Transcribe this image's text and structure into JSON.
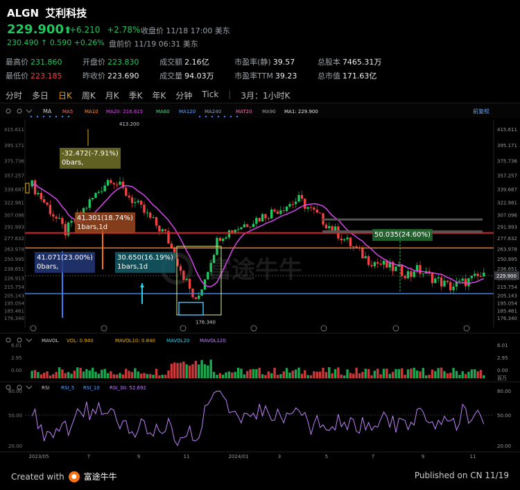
{
  "header": {
    "ticker": "ALGN",
    "name": "艾利科技",
    "price": "229.900",
    "arrow": "⬆",
    "change": "+6.210",
    "change_pct": "+2.78%",
    "status": "收盘价 11/18 17:00 美东",
    "pre_price": "230.490 ↑ 0.590 +0.26%",
    "pre_status": "盘前价 11/19 06:31 美东"
  },
  "stats": [
    {
      "k": "最高价",
      "v": "231.860",
      "tone": "up"
    },
    {
      "k": "开盘价",
      "v": "223.830",
      "tone": "up"
    },
    {
      "k": "成交额",
      "v": "2.16亿",
      "tone": ""
    },
    {
      "k": "市盈率(静)",
      "v": "39.57",
      "tone": ""
    },
    {
      "k": "总股本",
      "v": "7465.31万",
      "tone": ""
    },
    {
      "k": "最低价",
      "v": "223.185",
      "tone": "down"
    },
    {
      "k": "昨收价",
      "v": "223.690",
      "tone": ""
    },
    {
      "k": "成交量",
      "v": "94.03万",
      "tone": ""
    },
    {
      "k": "市盈率TTM",
      "v": "39.23",
      "tone": ""
    },
    {
      "k": "总市值",
      "v": "171.63亿",
      "tone": ""
    }
  ],
  "tabs": [
    "分时",
    "多日",
    "日K",
    "周K",
    "月K",
    "季K",
    "年K",
    "分钟",
    "Tick"
  ],
  "active_tab": "日K",
  "period": "3月：1小时K",
  "toolbar": {
    "ma": "MA",
    "ma5": "MA5",
    "ma10": "MA10",
    "ma20": "MA20: 216.615",
    "ma60": "MA60",
    "ma120": "MA120",
    "ma240": "MA240",
    "mat20": "MAT20",
    "ma90": "MA90",
    "ma1": "MA1: 229.900",
    "fq": "前复权"
  },
  "annotations": [
    {
      "text1": "-32.472(-7.91%)",
      "text2": "0bars,"
    },
    {
      "text1": "41.301(18.74%)",
      "text2": "1bars,1d"
    },
    {
      "text1": "41.071(23.00%)",
      "text2": "0bars,"
    },
    {
      "text1": "30.650(16.19%)",
      "text2": "1bars,1d"
    },
    {
      "text1": "50.035(24.60%)",
      "text2": ""
    }
  ],
  "peak_label": "413.200",
  "low_label": "176.340",
  "price_axis": [
    "415.611",
    "395.171",
    "375.736",
    "357.257",
    "339.687",
    "322.981",
    "307.096",
    "291.993",
    "277.632",
    "263.978",
    "250.995",
    "238.651",
    "226.913",
    "215.754",
    "205.143",
    "195.054",
    "185.461",
    "176.340"
  ],
  "current_price_tag": "229.900",
  "volume_panel": {
    "label": "MAVOL",
    "vol": "VOL: 0.940",
    "mavol10": "MAVOL10: 0.840",
    "mavol20": "MAVOL20",
    "mavol120": "MAVOL120",
    "axis": [
      "6.01",
      "2.95",
      "0.00"
    ],
    "unit": "百万"
  },
  "rsi_panel": {
    "label": "RSI",
    "rsi5": "RSI_5",
    "rsi10": "RSI_10",
    "rsi30": "RSI_30: 52.692",
    "axis": [
      "80.00",
      "50.00",
      "20.00"
    ]
  },
  "x_axis": [
    "2023/05",
    "7",
    "9",
    "11",
    "2024/01",
    "3",
    "5",
    "7",
    "9",
    "11"
  ],
  "watermark": "富途牛牛",
  "footer": {
    "created": "Created with",
    "brand": "富途牛牛",
    "published": "Published on CN 11/19"
  },
  "colors": {
    "up": "#22c55e",
    "down": "#ef4444",
    "ma20": "#d946ef",
    "rsi": "#c084fc",
    "accent": "#f59e0b"
  }
}
